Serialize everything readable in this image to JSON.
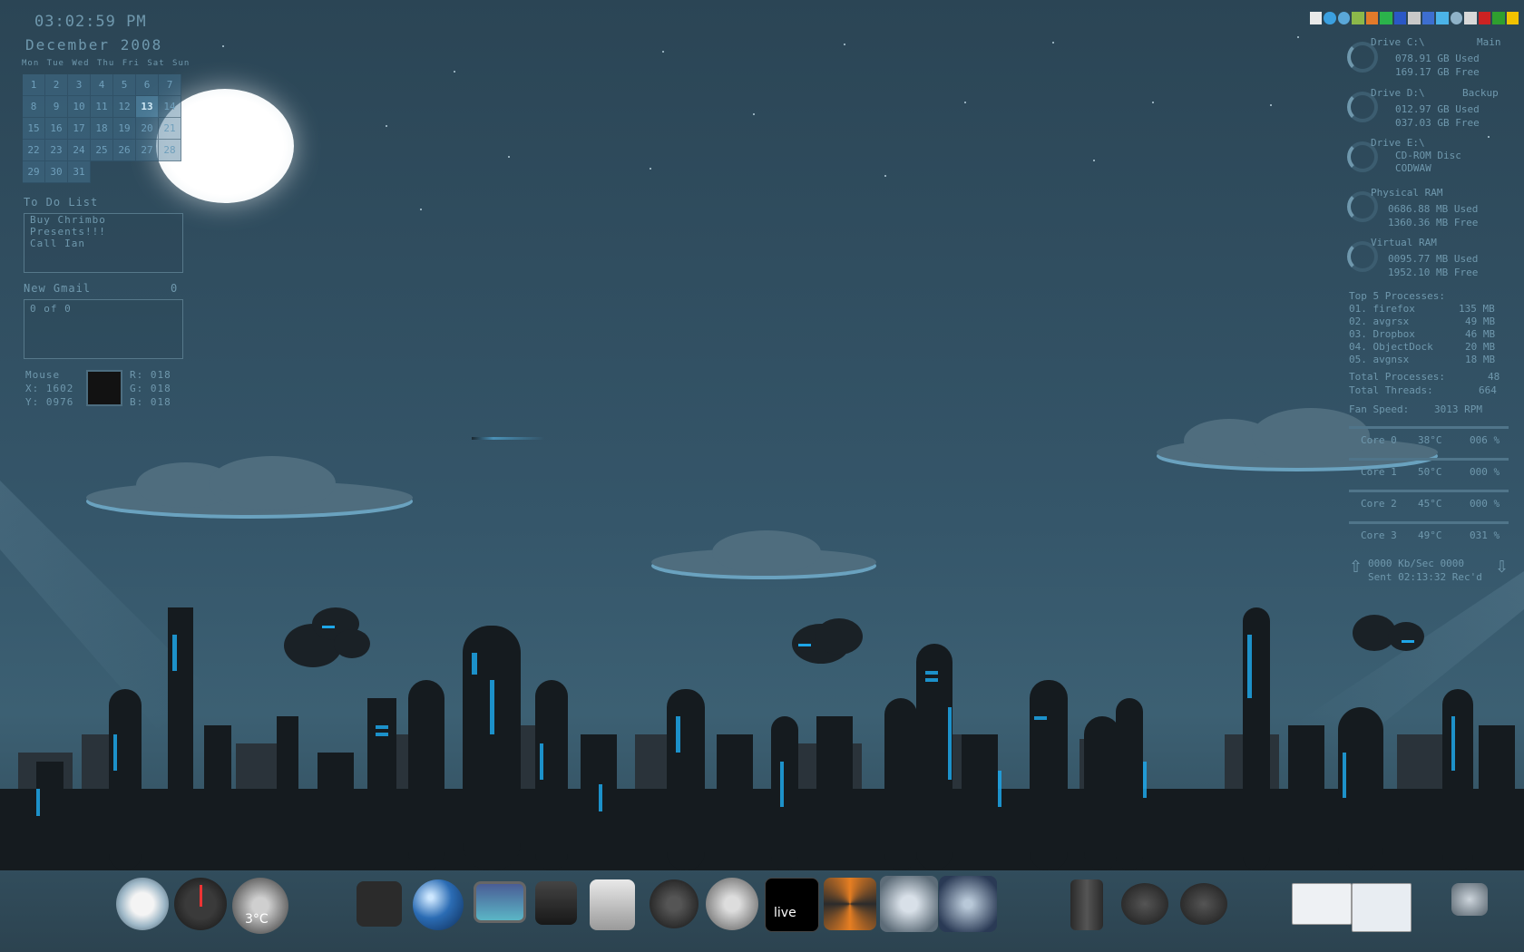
{
  "clock": {
    "time": "03:02:59 PM",
    "month": "December 2008",
    "weekdays": "Mon Tue Wed Thu Fri Sat Sun"
  },
  "calendar": {
    "days": [
      "1",
      "2",
      "3",
      "4",
      "5",
      "6",
      "7",
      "8",
      "9",
      "10",
      "11",
      "12",
      "13",
      "14",
      "15",
      "16",
      "17",
      "18",
      "19",
      "20",
      "21",
      "22",
      "23",
      "24",
      "25",
      "26",
      "27",
      "28",
      "29",
      "30",
      "31"
    ],
    "today": "13"
  },
  "todo": {
    "title": "To Do List",
    "items": [
      "Buy Chrimbo",
      "Presents!!!",
      "Call Ian"
    ]
  },
  "gmail": {
    "title": "New Gmail",
    "count": "0",
    "summary": "0 of 0"
  },
  "mouse": {
    "label": "Mouse",
    "x": "X: 1602",
    "y": "Y: 0976",
    "r": "R: 018",
    "g": "G: 018",
    "b": "B: 018"
  },
  "drives": [
    {
      "name": "Drive C:\\",
      "tag": "Main",
      "line1": "078.91 GB Used",
      "line2": "169.17 GB Free"
    },
    {
      "name": "Drive D:\\",
      "tag": "Backup",
      "line1": "012.97 GB Used",
      "line2": "037.03 GB Free"
    },
    {
      "name": "Drive E:\\",
      "tag": "",
      "line1": "CD-ROM Disc",
      "line2": "CODWAW"
    },
    {
      "name": "Physical RAM",
      "tag": "",
      "line1": "0686.88 MB Used",
      "line2": "1360.36 MB Free"
    },
    {
      "name": "Virtual RAM",
      "tag": "",
      "line1": "0095.77 MB Used",
      "line2": "1952.10 MB Free"
    }
  ],
  "processes": {
    "title": "Top 5 Processes:",
    "list": [
      {
        "name": "01. firefox",
        "mem": "135 MB"
      },
      {
        "name": "02. avgrsx",
        "mem": "49 MB"
      },
      {
        "name": "03. Dropbox",
        "mem": "46 MB"
      },
      {
        "name": "04. ObjectDock",
        "mem": "20 MB"
      },
      {
        "name": "05. avgnsx",
        "mem": "18 MB"
      }
    ],
    "total_label": "Total Processes:",
    "total": "48",
    "threads_label": "Total Threads:",
    "threads": "664",
    "fan_label": "Fan Speed:",
    "fan": "3013 RPM"
  },
  "cores": [
    {
      "label": "Core 0",
      "temp": "38°C",
      "load": "006 %"
    },
    {
      "label": "Core 1",
      "temp": "50°C",
      "load": "000 %"
    },
    {
      "label": "Core 2",
      "temp": "45°C",
      "load": "000 %"
    },
    {
      "label": "Core 3",
      "temp": "49°C",
      "load": "031 %"
    }
  ],
  "network": {
    "line1": "0000 Kb/Sec 0000",
    "line2": "Sent 02:13:32 Rec'd"
  },
  "dock": {
    "weather": "3°C",
    "live_label": "live"
  },
  "colors": {
    "accent": "#6f98ad",
    "glow": "#1ea6e8",
    "city": "#141a1e"
  }
}
